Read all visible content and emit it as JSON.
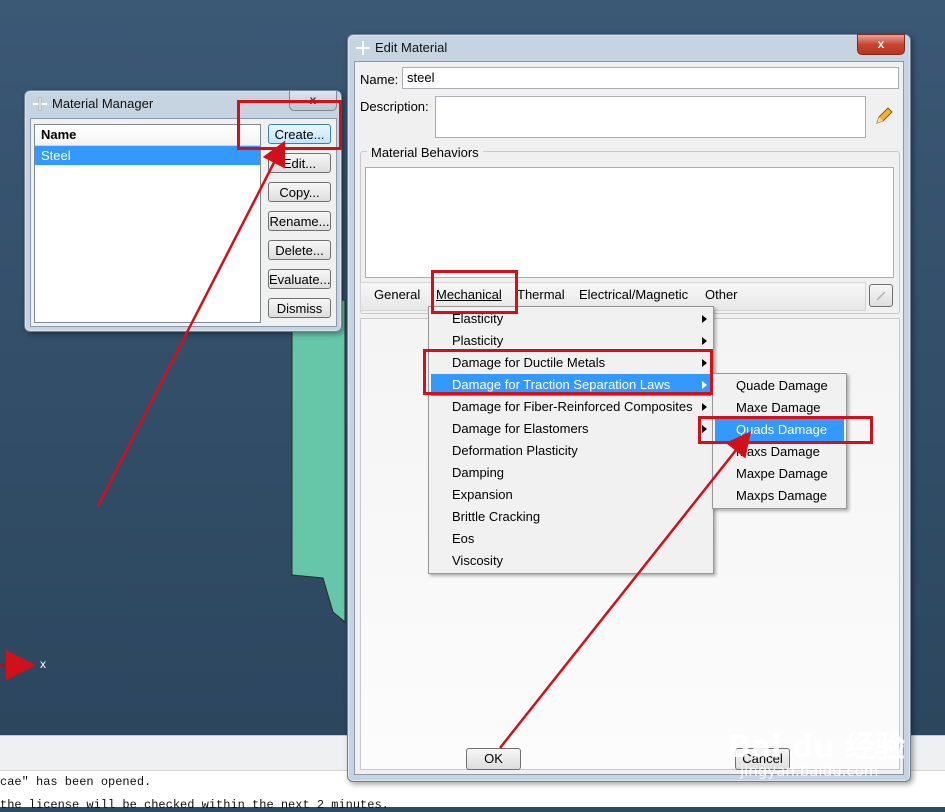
{
  "material_manager": {
    "title": "Material Manager",
    "close": "x",
    "list_header": "Name",
    "items": [
      "Steel"
    ],
    "buttons": {
      "create": "Create...",
      "edit": "Edit...",
      "copy": "Copy...",
      "rename": "Rename...",
      "delete": "Delete...",
      "evaluate": "Evaluate...",
      "dismiss": "Dismiss"
    }
  },
  "edit_material": {
    "title": "Edit Material",
    "close": "x",
    "name_label": "Name:",
    "name_value": "steel",
    "description_label": "Description:",
    "description_value": "",
    "behaviors_group": "Material Behaviors",
    "menubar": [
      "General",
      "Mechanical",
      "Thermal",
      "Electrical/Magnetic",
      "Other"
    ],
    "ok": "OK",
    "cancel": "Cancel"
  },
  "mechanical_menu": {
    "items": [
      {
        "label": "Elasticity",
        "submenu": true
      },
      {
        "label": "Plasticity",
        "submenu": true
      },
      {
        "label": "Damage for Ductile Metals",
        "submenu": true
      },
      {
        "label": "Damage for Traction Separation Laws",
        "submenu": true,
        "highlighted": true
      },
      {
        "label": "Damage for Fiber-Reinforced Composites",
        "submenu": true
      },
      {
        "label": "Damage for Elastomers",
        "submenu": true
      },
      {
        "label": "Deformation Plasticity",
        "submenu": false
      },
      {
        "label": "Damping",
        "submenu": false
      },
      {
        "label": "Expansion",
        "submenu": false
      },
      {
        "label": "Brittle Cracking",
        "submenu": false
      },
      {
        "label": "Eos",
        "submenu": false
      },
      {
        "label": "Viscosity",
        "submenu": false
      }
    ]
  },
  "damage_submenu": {
    "items": [
      {
        "label": "Quade Damage"
      },
      {
        "label": "Maxe Damage"
      },
      {
        "label": "Quads Damage",
        "highlighted": true
      },
      {
        "label": "Maxs Damage"
      },
      {
        "label": "Maxpe Damage"
      },
      {
        "label": "Maxps Damage"
      }
    ]
  },
  "console": {
    "line1": "cae\" has been opened.",
    "line2": "the license will be checked within the next 2 minutes."
  },
  "viewport": {
    "marker": "x"
  },
  "watermark": {
    "brand": "Bai du 经验",
    "url": "jingyan.baidu.com"
  },
  "colors": {
    "highlight": "#3399ff",
    "annotation_red": "#d0101b",
    "part_fill": "#66c7a8"
  }
}
